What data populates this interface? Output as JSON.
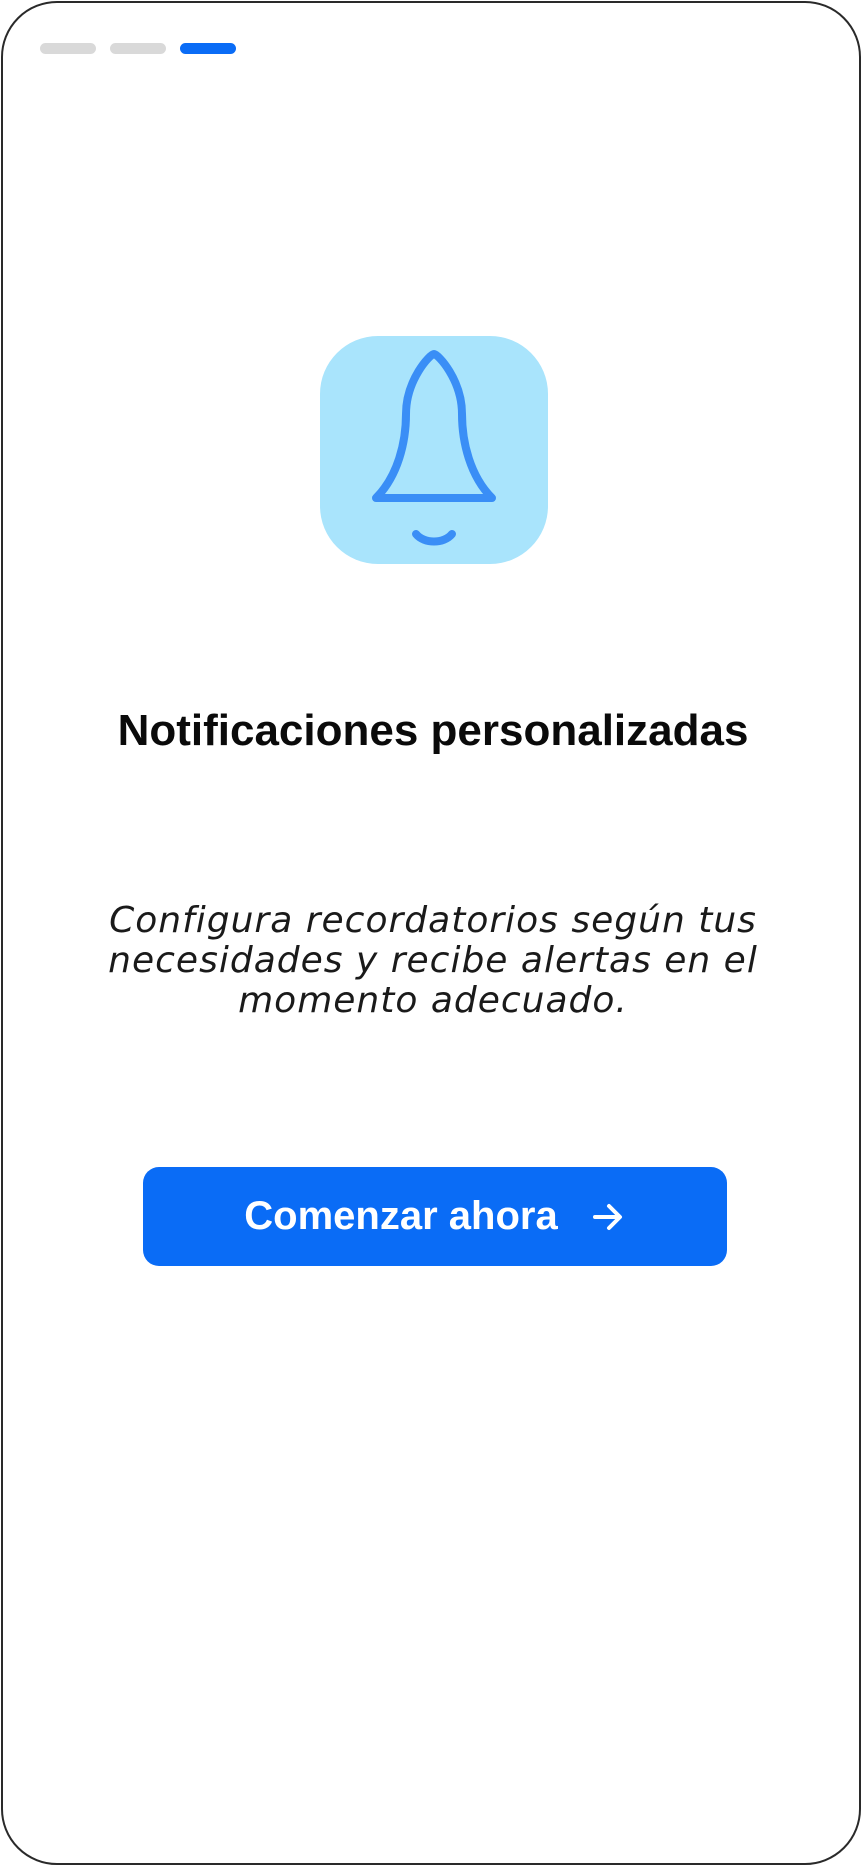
{
  "progress": {
    "steps": 3,
    "active_step": 3
  },
  "hero": {
    "icon": "bell-icon"
  },
  "title": "Notificaciones personalizadas",
  "description": "Configura recordatorios según tus necesidades y recibe alertas en el momento adecuado.",
  "cta": {
    "label": "Comenzar ahora",
    "icon": "arrow-right-icon"
  },
  "colors": {
    "accent": "#0a6cf6",
    "icon_tile_bg": "#a9e4fc",
    "icon_stroke": "#3a8ef6",
    "inactive_step": "#d9d9d9"
  }
}
